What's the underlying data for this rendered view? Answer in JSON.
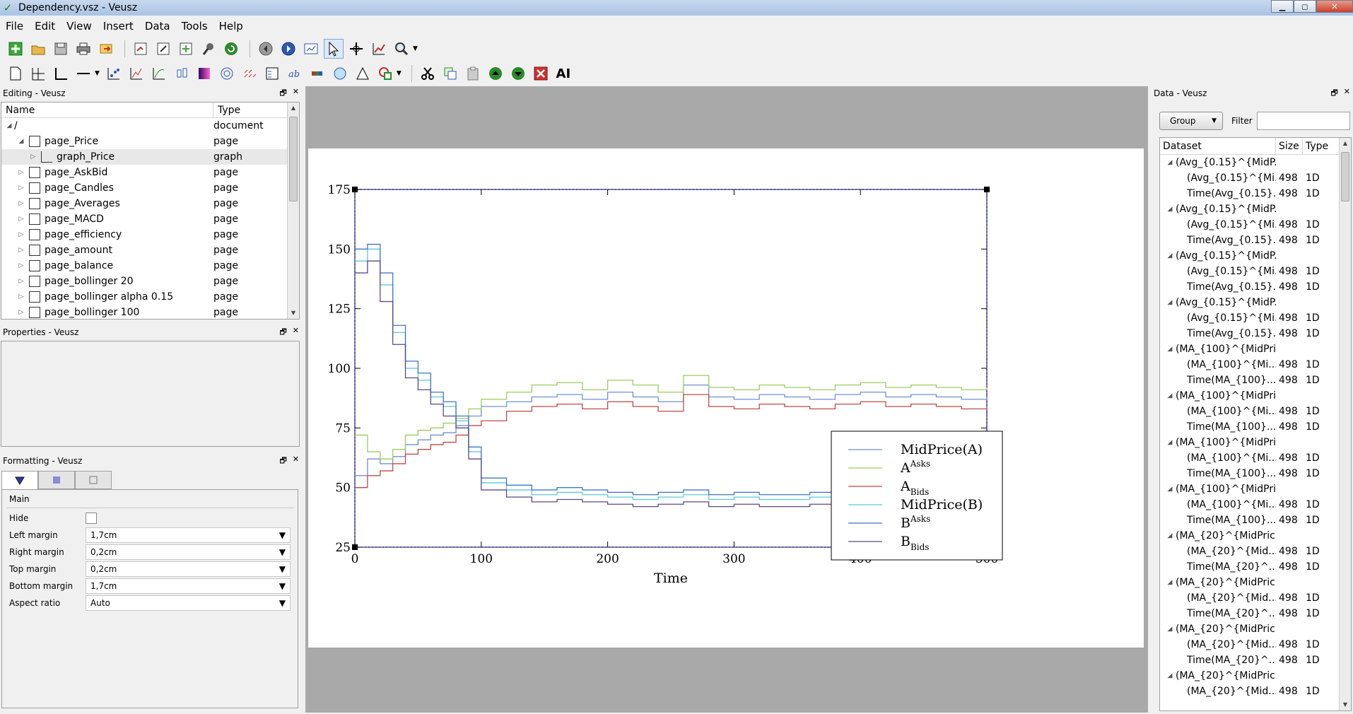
{
  "window": {
    "title": "Dependency.vsz - Veusz"
  },
  "menu": [
    "File",
    "Edit",
    "View",
    "Insert",
    "Data",
    "Tools",
    "Help"
  ],
  "toolbar2_text_button": "AI",
  "editing": {
    "title": "Editing - Veusz",
    "col_name": "Name",
    "col_type": "Type",
    "rows": [
      {
        "name": "/",
        "type": "document",
        "level": 0,
        "kind": "root",
        "expanded": true
      },
      {
        "name": "page_Price",
        "type": "page",
        "level": 1,
        "kind": "page",
        "expanded": true
      },
      {
        "name": "graph_Price",
        "type": "graph",
        "level": 2,
        "kind": "graph",
        "expanded": false,
        "selected": true
      },
      {
        "name": "page_AskBid",
        "type": "page",
        "level": 1,
        "kind": "page"
      },
      {
        "name": "page_Candles",
        "type": "page",
        "level": 1,
        "kind": "page"
      },
      {
        "name": "page_Averages",
        "type": "page",
        "level": 1,
        "kind": "page"
      },
      {
        "name": "page_MACD",
        "type": "page",
        "level": 1,
        "kind": "page"
      },
      {
        "name": "page_efficiency",
        "type": "page",
        "level": 1,
        "kind": "page"
      },
      {
        "name": "page_amount",
        "type": "page",
        "level": 1,
        "kind": "page"
      },
      {
        "name": "page_balance",
        "type": "page",
        "level": 1,
        "kind": "page"
      },
      {
        "name": "page_bollinger 20",
        "type": "page",
        "level": 1,
        "kind": "page"
      },
      {
        "name": "page_bollinger alpha 0.15",
        "type": "page",
        "level": 1,
        "kind": "page"
      },
      {
        "name": "page_bollinger 100",
        "type": "page",
        "level": 1,
        "kind": "page"
      }
    ]
  },
  "properties": {
    "title": "Properties - Veusz"
  },
  "formatting": {
    "title": "Formatting - Veusz",
    "group": "Main",
    "hide_label": "Hide",
    "fields": [
      {
        "label": "Left margin",
        "value": "1,7cm"
      },
      {
        "label": "Right margin",
        "value": "0,2cm"
      },
      {
        "label": "Top margin",
        "value": "0,2cm"
      },
      {
        "label": "Bottom margin",
        "value": "1,7cm"
      },
      {
        "label": "Aspect ratio",
        "value": "Auto"
      }
    ]
  },
  "datadock": {
    "title": "Data - Veusz",
    "group_button": "Group",
    "filter_label": "Filter",
    "filter_value": "",
    "col_dataset": "Dataset",
    "col_size": "Size",
    "col_type": "Type",
    "rows": [
      {
        "name": "(Avg_{0.15}^{MidP...",
        "group": true
      },
      {
        "name": "(Avg_{0.15}^{Mi...",
        "size": "498",
        "type": "1D"
      },
      {
        "name": "Time(Avg_{0.15}...",
        "size": "498",
        "type": "1D"
      },
      {
        "name": "(Avg_{0.15}^{MidP...",
        "group": true
      },
      {
        "name": "(Avg_{0.15}^{Mi...",
        "size": "498",
        "type": "1D"
      },
      {
        "name": "Time(Avg_{0.15}...",
        "size": "498",
        "type": "1D"
      },
      {
        "name": "(Avg_{0.15}^{MidP...",
        "group": true
      },
      {
        "name": "(Avg_{0.15}^{Mi...",
        "size": "498",
        "type": "1D"
      },
      {
        "name": "Time(Avg_{0.15}...",
        "size": "498",
        "type": "1D"
      },
      {
        "name": "(Avg_{0.15}^{MidP...",
        "group": true
      },
      {
        "name": "(Avg_{0.15}^{Mi...",
        "size": "498",
        "type": "1D"
      },
      {
        "name": "Time(Avg_{0.15}...",
        "size": "498",
        "type": "1D"
      },
      {
        "name": "(MA_{100}^{MidPri...",
        "group": true
      },
      {
        "name": "(MA_{100}^{Mi...",
        "size": "498",
        "type": "1D"
      },
      {
        "name": "Time(MA_{100}...",
        "size": "498",
        "type": "1D"
      },
      {
        "name": "(MA_{100}^{MidPri...",
        "group": true
      },
      {
        "name": "(MA_{100}^{Mi...",
        "size": "498",
        "type": "1D"
      },
      {
        "name": "Time(MA_{100}...",
        "size": "498",
        "type": "1D"
      },
      {
        "name": "(MA_{100}^{MidPri...",
        "group": true
      },
      {
        "name": "(MA_{100}^{Mi...",
        "size": "498",
        "type": "1D"
      },
      {
        "name": "Time(MA_{100}...",
        "size": "498",
        "type": "1D"
      },
      {
        "name": "(MA_{100}^{MidPri...",
        "group": true
      },
      {
        "name": "(MA_{100}^{Mi...",
        "size": "498",
        "type": "1D"
      },
      {
        "name": "Time(MA_{100}...",
        "size": "498",
        "type": "1D"
      },
      {
        "name": "(MA_{20}^{MidPric...",
        "group": true
      },
      {
        "name": "(MA_{20}^{Mid...",
        "size": "498",
        "type": "1D"
      },
      {
        "name": "Time(MA_{20}^...",
        "size": "498",
        "type": "1D"
      },
      {
        "name": "(MA_{20}^{MidPric...",
        "group": true
      },
      {
        "name": "(MA_{20}^{Mid...",
        "size": "498",
        "type": "1D"
      },
      {
        "name": "Time(MA_{20}^...",
        "size": "498",
        "type": "1D"
      },
      {
        "name": "(MA_{20}^{MidPric...",
        "group": true
      },
      {
        "name": "(MA_{20}^{Mid...",
        "size": "498",
        "type": "1D"
      },
      {
        "name": "Time(MA_{20}^...",
        "size": "498",
        "type": "1D"
      },
      {
        "name": "(MA_{20}^{MidPric...",
        "group": true
      },
      {
        "name": "(MA_{20}^{Mid...",
        "size": "498",
        "type": "1D"
      }
    ]
  },
  "chart_data": {
    "type": "line",
    "xlabel": "Time",
    "ylabel": "",
    "xlim": [
      0,
      500
    ],
    "ylim": [
      25,
      175
    ],
    "xticks": [
      0,
      100,
      200,
      300,
      400,
      500
    ],
    "yticks": [
      25,
      50,
      75,
      100,
      125,
      150,
      175
    ],
    "legend_position": "bottom-right",
    "x": [
      0,
      10,
      20,
      30,
      40,
      50,
      60,
      70,
      80,
      90,
      100,
      120,
      140,
      160,
      180,
      200,
      220,
      240,
      260,
      280,
      300,
      320,
      340,
      360,
      380,
      400,
      420,
      440,
      460,
      480,
      500
    ],
    "series": [
      {
        "name": "MidPrice(A)",
        "label_base": "MidPrice(A)",
        "sub": "",
        "sup": "",
        "color": "#6f8fd8",
        "values": [
          55,
          62,
          60,
          63,
          68,
          70,
          72,
          73,
          76,
          80,
          84,
          86,
          88,
          89,
          87,
          90,
          88,
          86,
          93,
          88,
          87,
          89,
          88,
          87,
          89,
          90,
          88,
          89,
          88,
          87,
          88
        ]
      },
      {
        "name": "A^Asks",
        "label_base": "A",
        "sub": "",
        "sup": "Asks",
        "color": "#9ccc5e",
        "values": [
          72,
          65,
          62,
          66,
          72,
          74,
          75,
          77,
          79,
          83,
          87,
          90,
          93,
          94,
          91,
          95,
          93,
          90,
          97,
          92,
          91,
          93,
          92,
          91,
          93,
          94,
          92,
          93,
          92,
          91,
          92
        ]
      },
      {
        "name": "A_Bids",
        "label_base": "A",
        "sub": "Bids",
        "sup": "",
        "color": "#c24848",
        "values": [
          50,
          55,
          57,
          60,
          64,
          66,
          68,
          69,
          72,
          76,
          78,
          82,
          84,
          85,
          83,
          86,
          84,
          82,
          89,
          84,
          83,
          85,
          84,
          83,
          85,
          86,
          84,
          85,
          84,
          83,
          84
        ]
      },
      {
        "name": "MidPrice(B)",
        "label_base": "MidPrice(B)",
        "sub": "",
        "sup": "",
        "color": "#5cc8d8",
        "values": [
          145,
          150,
          135,
          115,
          100,
          95,
          88,
          84,
          78,
          65,
          52,
          49,
          47,
          48,
          47,
          46,
          45,
          46,
          47,
          45,
          46,
          45,
          45,
          46,
          45,
          45,
          44,
          46,
          45,
          44,
          45
        ]
      },
      {
        "name": "B^Asks",
        "label_base": "B",
        "sub": "",
        "sup": "Asks",
        "color": "#3c78c0",
        "values": [
          150,
          152,
          140,
          118,
          103,
          98,
          90,
          86,
          80,
          67,
          54,
          51,
          49,
          50,
          49,
          48,
          47,
          48,
          49,
          47,
          48,
          47,
          47,
          48,
          47,
          47,
          46,
          48,
          47,
          46,
          47
        ]
      },
      {
        "name": "B_Bids",
        "label_base": "B",
        "sub": "Bids",
        "sup": "",
        "color": "#5a4a86",
        "values": [
          140,
          145,
          128,
          110,
          96,
          91,
          85,
          80,
          75,
          62,
          49,
          46,
          44,
          45,
          44,
          43,
          42,
          43,
          44,
          42,
          43,
          42,
          42,
          43,
          42,
          42,
          41,
          43,
          42,
          41,
          42
        ]
      }
    ]
  }
}
